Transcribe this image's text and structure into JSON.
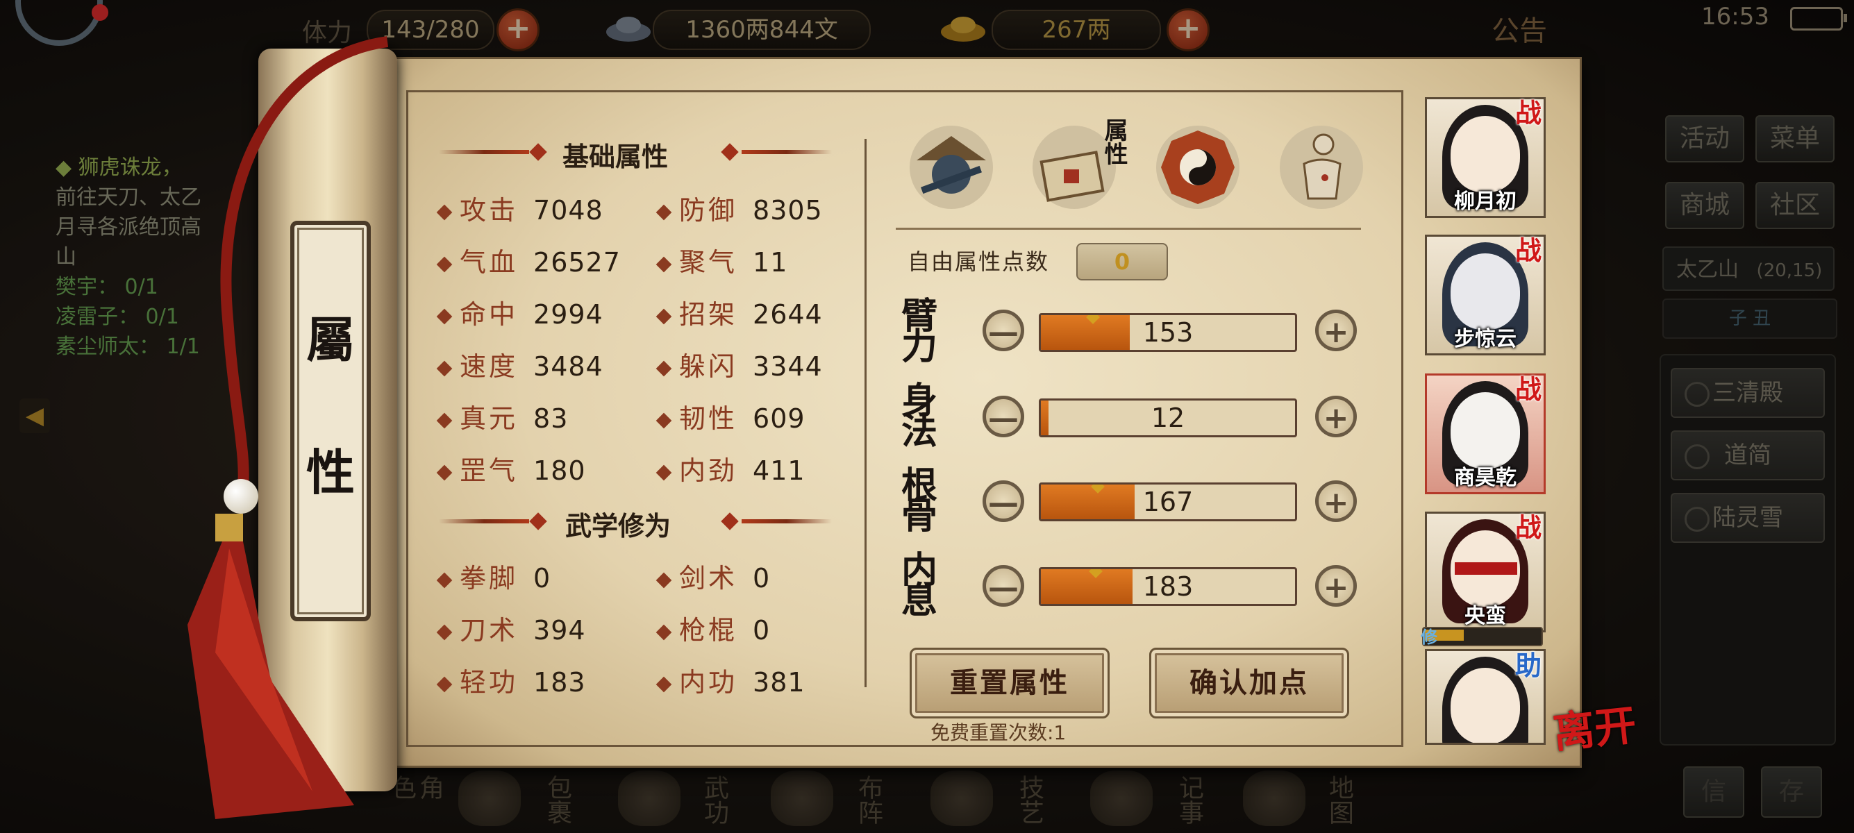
{
  "topbar": {
    "stamina_label": "体力",
    "stamina": "143/280",
    "money": "1360两844文",
    "gold": "267两",
    "announce": "公告",
    "time": "16:53"
  },
  "quest": {
    "title": "◆ 狮虎诛龙，",
    "desc_lines": [
      "前往天刀、太乙",
      "月寻各派绝顶高",
      "山"
    ],
    "targets": [
      {
        "name": "樊宇：",
        "progress": "0/1"
      },
      {
        "name": "凌雷子：",
        "progress": "0/1"
      },
      {
        "name": "素尘师太：",
        "progress": "1/1"
      }
    ]
  },
  "right_menu": {
    "activity": "活动",
    "menu": "菜单",
    "shop": "商城",
    "community": "社区",
    "location_name": "太乙山",
    "location_coord": "(20,15)",
    "map_strip": "子  丑",
    "scenes": [
      "三清殿",
      "道简",
      "陆灵雪"
    ],
    "mail": "信",
    "save": "存"
  },
  "bottom_nav": [
    "角色",
    "包裹",
    "武功",
    "布阵",
    "技艺",
    "记事",
    "地图"
  ],
  "scroll_title": [
    "屬",
    "性"
  ],
  "basic": {
    "header": "基础属性",
    "stats": [
      {
        "label": "攻击",
        "value": "7048"
      },
      {
        "label": "防御",
        "value": "8305"
      },
      {
        "label": "气血",
        "value": "26527"
      },
      {
        "label": "聚气",
        "value": "11"
      },
      {
        "label": "命中",
        "value": "2994"
      },
      {
        "label": "招架",
        "value": "2644"
      },
      {
        "label": "速度",
        "value": "3484"
      },
      {
        "label": "躲闪",
        "value": "3344"
      },
      {
        "label": "真元",
        "value": "83"
      },
      {
        "label": "韧性",
        "value": "609"
      },
      {
        "label": "罡气",
        "value": "180"
      },
      {
        "label": "内劲",
        "value": "411"
      }
    ]
  },
  "martial": {
    "header": "武学修为",
    "stats": [
      {
        "label": "拳脚",
        "value": "0"
      },
      {
        "label": "剑术",
        "value": "0"
      },
      {
        "label": "刀术",
        "value": "394"
      },
      {
        "label": "枪棍",
        "value": "0"
      },
      {
        "label": "轻功",
        "value": "183"
      },
      {
        "label": "内功",
        "value": "381"
      }
    ]
  },
  "tabs": {
    "active_label": "属性"
  },
  "attributes": {
    "free_label": "自由属性点数",
    "free_points": "0",
    "rows": [
      {
        "label": "臂力",
        "value": "153",
        "fill": 0.35
      },
      {
        "label": "身法",
        "value": "12",
        "fill": 0.03
      },
      {
        "label": "根骨",
        "value": "167",
        "fill": 0.37
      },
      {
        "label": "内息",
        "value": "183",
        "fill": 0.36
      }
    ],
    "minus": "—",
    "plus": "+",
    "reset_button": "重置属性",
    "confirm_button": "确认加点",
    "reset_count": "免费重置次数:1"
  },
  "party": [
    {
      "name": "柳月初",
      "badge": "战"
    },
    {
      "name": "步惊云",
      "badge": "战"
    },
    {
      "name": "商昊乾",
      "badge": "战"
    },
    {
      "name": "央蛮",
      "badge": "战",
      "xiu": "修"
    },
    {
      "name": "",
      "badge": "助"
    }
  ],
  "leave_button": "离开",
  "colors": {
    "accent_red": "#d01818",
    "bar_orange": "#e07a22",
    "assist_blue": "#2868c8"
  }
}
